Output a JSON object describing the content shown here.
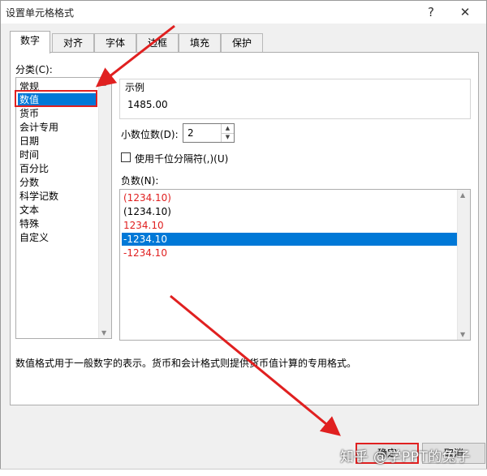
{
  "window": {
    "title": "设置单元格格式",
    "help_symbol": "?",
    "close_symbol": "✕"
  },
  "tabs": [
    {
      "label": "数字",
      "active": true
    },
    {
      "label": "对齐"
    },
    {
      "label": "字体"
    },
    {
      "label": "边框"
    },
    {
      "label": "填充"
    },
    {
      "label": "保护"
    }
  ],
  "category": {
    "label": "分类(C):",
    "items": [
      "常规",
      "数值",
      "货币",
      "会计专用",
      "日期",
      "时间",
      "百分比",
      "分数",
      "科学记数",
      "文本",
      "特殊",
      "自定义"
    ],
    "selected_index": 1
  },
  "sample": {
    "label": "示例",
    "value": "1485.00"
  },
  "decimal_places": {
    "label": "小数位数(D):",
    "value": "2"
  },
  "thousands_separator": {
    "label": "使用千位分隔符(,)(U)",
    "checked": false
  },
  "negative_numbers": {
    "label": "负数(N):",
    "items": [
      {
        "text": "(1234.10)",
        "red": true
      },
      {
        "text": "(1234.10)",
        "red": false
      },
      {
        "text": "1234.10",
        "red": true
      },
      {
        "text": "-1234.10",
        "red": false,
        "selected": true
      },
      {
        "text": "-1234.10",
        "red": true
      }
    ]
  },
  "description": "数值格式用于一般数字的表示。货币和会计格式则提供货币值计算的专用格式。",
  "footer": {
    "ok_label": "确定",
    "cancel_label": "取消"
  },
  "watermark": "知乎 @学PPT的兔子",
  "colors": {
    "selection": "#0078d7",
    "annotation_red": "#e02020",
    "negative_red": "#e02020"
  }
}
